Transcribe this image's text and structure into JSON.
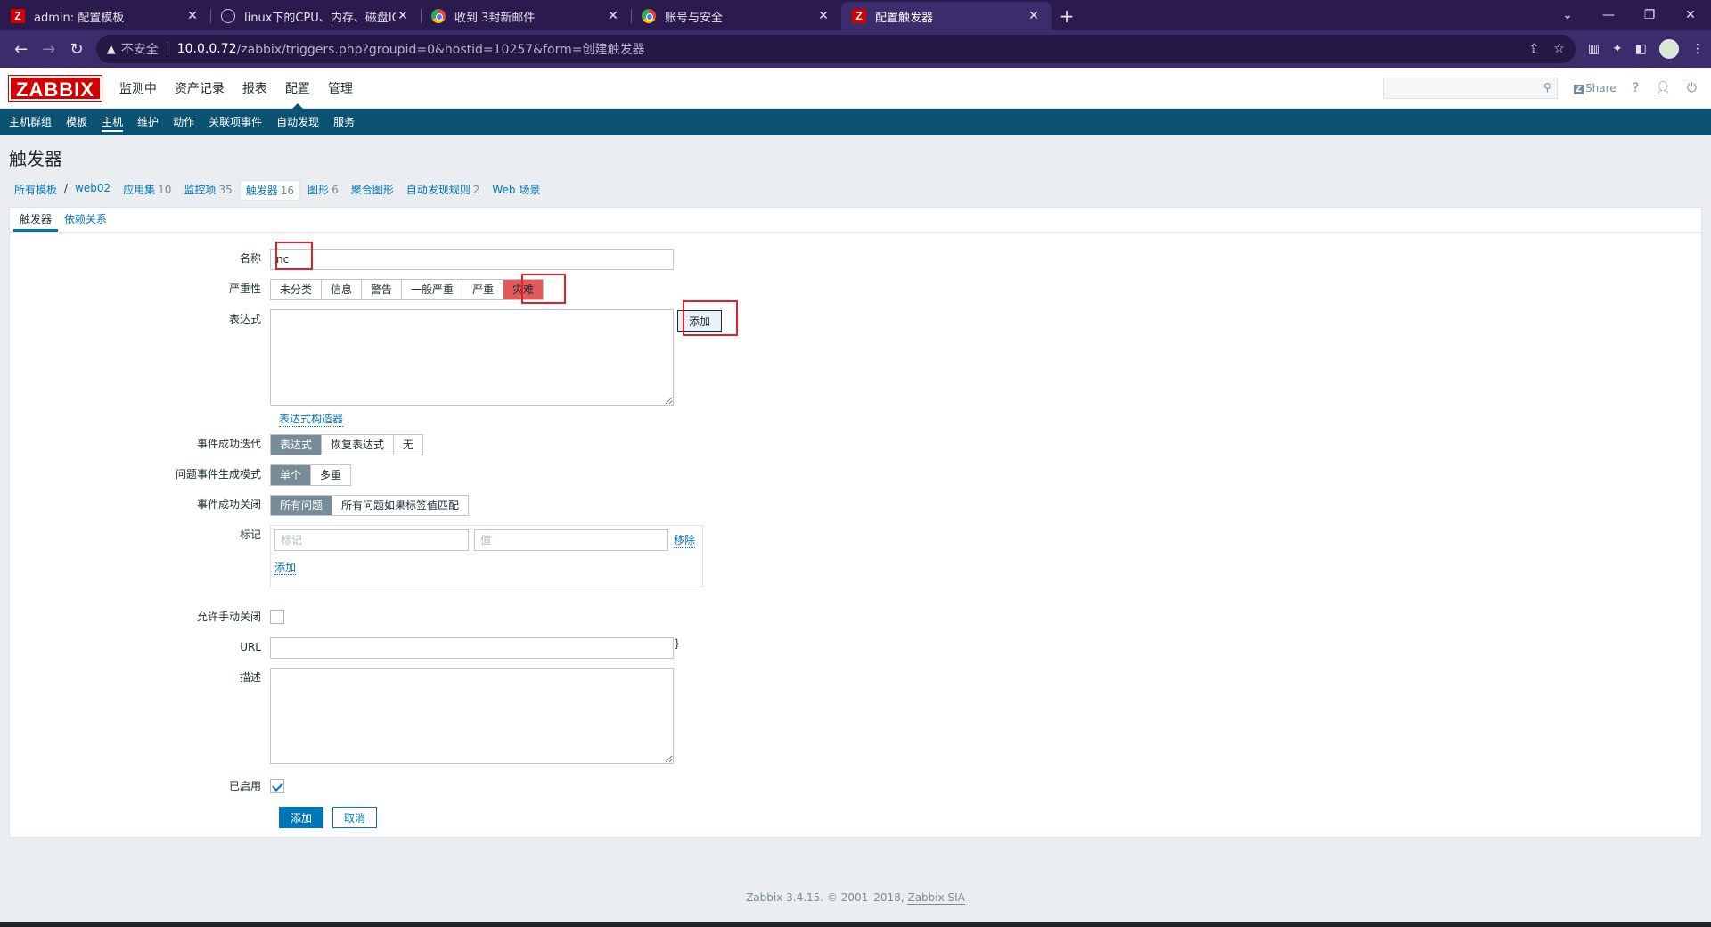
{
  "browser": {
    "tabs": [
      {
        "title": "admin: 配置模板",
        "favicon": "zabbix-icon",
        "active": false
      },
      {
        "title": "linux下的CPU、内存、磁盘IO、",
        "favicon": "tux-icon",
        "active": false
      },
      {
        "title": "收到 3封新邮件",
        "favicon": "chrome-icon",
        "active": false
      },
      {
        "title": "账号与安全",
        "favicon": "chrome-icon",
        "active": false
      },
      {
        "title": "配置触发器",
        "favicon": "zabbix-icon",
        "active": true
      }
    ],
    "insecure_label": "不安全",
    "url_host": "10.0.0.72",
    "url_rest": "/zabbix/triggers.php?groupid=0&hostid=10257&form=创建触发器"
  },
  "zabbix": {
    "logo": "ZABBIX",
    "top_menu": [
      "监测中",
      "资产记录",
      "报表",
      "配置",
      "管理"
    ],
    "active_top": "配置",
    "share_label": "Share",
    "sub_menu": [
      "主机群组",
      "模板",
      "主机",
      "维护",
      "动作",
      "关联项事件",
      "自动发现",
      "服务"
    ],
    "active_sub": "主机",
    "page_title": "触发器",
    "breadcrumbs": {
      "all_templates": "所有模板",
      "host": "web02",
      "items": [
        {
          "label": "应用集",
          "count": "10"
        },
        {
          "label": "监控项",
          "count": "35"
        },
        {
          "label": "触发器",
          "count": "16"
        },
        {
          "label": "图形",
          "count": "6"
        },
        {
          "label": "聚合图形",
          "count": ""
        },
        {
          "label": "自动发现规则",
          "count": "2"
        },
        {
          "label": "Web 场景",
          "count": ""
        }
      ]
    },
    "form_tabs": [
      "触发器",
      "依赖关系"
    ],
    "form": {
      "name_label": "名称",
      "name_value": "nc",
      "severity_label": "严重性",
      "severity_options": [
        "未分类",
        "信息",
        "警告",
        "一般严重",
        "严重",
        "灾难"
      ],
      "severity_selected": "灾难",
      "expression_label": "表达式",
      "expression_value": "",
      "add_expression_button": "添加",
      "expression_builder_link": "表达式构造器",
      "ok_event_label": "事件成功迭代",
      "ok_event_options": [
        "表达式",
        "恢复表达式",
        "无"
      ],
      "ok_event_selected": "表达式",
      "problem_mode_label": "问题事件生成模式",
      "problem_mode_options": [
        "单个",
        "多重"
      ],
      "problem_mode_selected": "单个",
      "ok_close_label": "事件成功关闭",
      "ok_close_options": [
        "所有问题",
        "所有问题如果标签值匹配"
      ],
      "ok_close_selected": "所有问题",
      "tags_label": "标记",
      "tag_placeholder": "标记",
      "value_placeholder": "值",
      "remove_link": "移除",
      "add_tag_link": "添加",
      "manual_close_label": "允许手动关闭",
      "manual_close_checked": false,
      "url_label": "URL",
      "url_value": "",
      "description_label": "描述",
      "description_value": "",
      "enabled_label": "已启用",
      "enabled_checked": true,
      "submit_button": "添加",
      "cancel_button": "取消"
    },
    "footer_text": "Zabbix 3.4.15. © 2001–2018, ",
    "footer_link": "Zabbix SIA"
  },
  "colors": {
    "zabbix_red": "#d40000",
    "nav_blue": "#0b5273",
    "link_blue": "#0275b8",
    "disaster": "#e45959",
    "highlight_red": "#e3202a"
  }
}
